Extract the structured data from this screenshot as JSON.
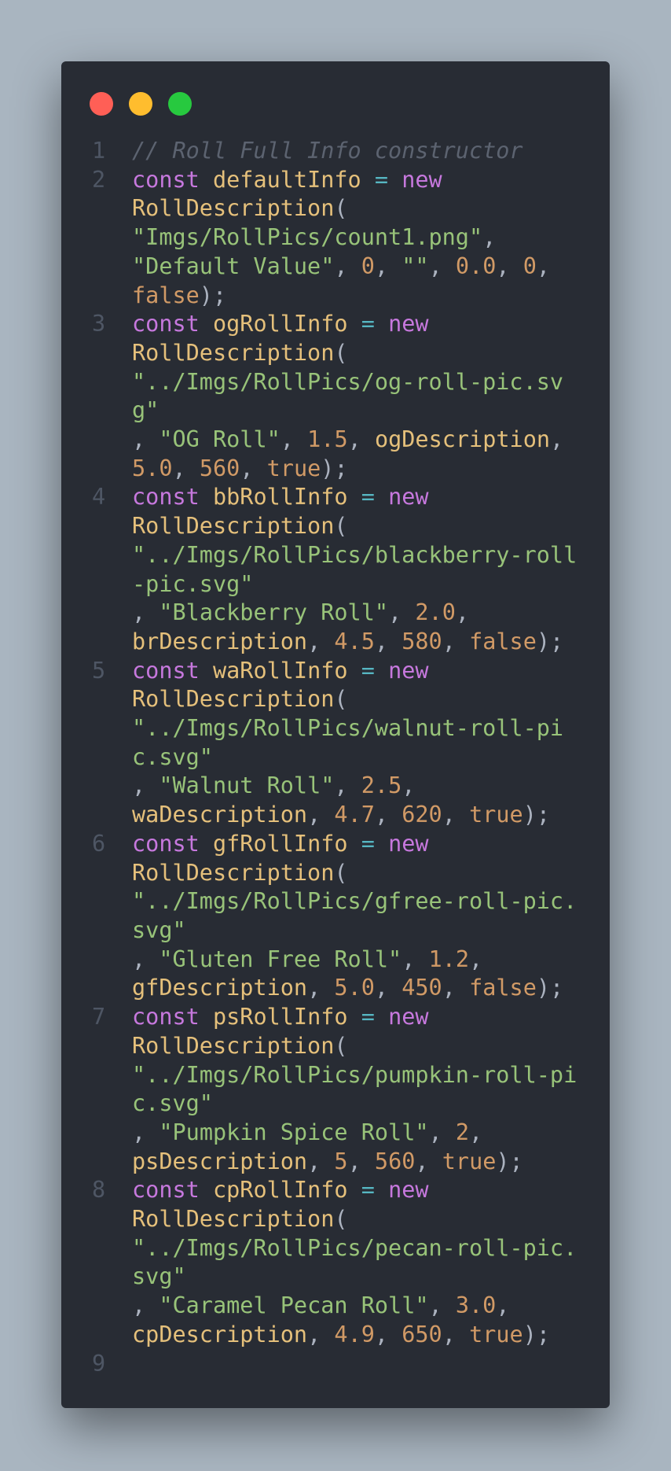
{
  "window": {
    "dots": [
      {
        "name": "close",
        "color": "#ff5f56"
      },
      {
        "name": "minimize",
        "color": "#ffbd2e"
      },
      {
        "name": "maximize",
        "color": "#27c93f"
      }
    ]
  },
  "code": {
    "comment": "// Roll Full Info constructor",
    "line_numbers": [
      "1",
      "2",
      "3",
      "4",
      "5",
      "6",
      "7",
      "8",
      "9"
    ],
    "entries": [
      {
        "kw": "const",
        "var": "defaultInfo",
        "op": "=",
        "new": "new",
        "cls": "RollDescription",
        "open": "(",
        "path": "\"Imgs/RollPics/count1.png\"",
        "sep1": ",",
        "name": "\"Default Value\"",
        "sep2": ",",
        "price": "0",
        "sep3": ",",
        "desc": "\"\"",
        "sep4": ",",
        "rating": "0.0",
        "sep5": ",",
        "count": "0",
        "sep6": ",",
        "flag": "false",
        "close": ");"
      },
      {
        "kw": "const",
        "var": "ogRollInfo",
        "op": "=",
        "new": "new",
        "cls": "RollDescription",
        "open": "(",
        "path": "\"../Imgs/RollPics/og-roll-pic.svg\"",
        "sep1": ",",
        "name": "\"OG Roll\"",
        "sep2": ",",
        "price": "1.5",
        "sep3": ",",
        "desc": "ogDescription",
        "sep4": ",",
        "rating": "5.0",
        "sep5": ",",
        "count": "560",
        "sep6": ",",
        "flag": "true",
        "close": ");"
      },
      {
        "kw": "const",
        "var": "bbRollInfo",
        "op": "=",
        "new": "new",
        "cls": "RollDescription",
        "open": "(",
        "path": "\"../Imgs/RollPics/blackberry-roll-pic.svg\"",
        "sep1": ",",
        "name": "\"Blackberry Roll\"",
        "sep2": ",",
        "price": "2.0",
        "sep3": ",",
        "desc": "brDescription",
        "sep4": ",",
        "rating": "4.5",
        "sep5": ",",
        "count": "580",
        "sep6": ",",
        "flag": "false",
        "close": ");"
      },
      {
        "kw": "const",
        "var": "waRollInfo",
        "op": "=",
        "new": "new",
        "cls": "RollDescription",
        "open": "(",
        "path": "\"../Imgs/RollPics/walnut-roll-pic.svg\"",
        "sep1": ",",
        "name": "\"Walnut Roll\"",
        "sep2": ",",
        "price": "2.5",
        "sep3": ",",
        "desc": "waDescription",
        "sep4": ",",
        "rating": "4.7",
        "sep5": ",",
        "count": "620",
        "sep6": ",",
        "flag": "true",
        "close": ");"
      },
      {
        "kw": "const",
        "var": "gfRollInfo",
        "op": "=",
        "new": "new",
        "cls": "RollDescription",
        "open": "(",
        "path": "\"../Imgs/RollPics/gfree-roll-pic.svg\"",
        "sep1": ",",
        "name": "\"Gluten Free Roll\"",
        "sep2": ",",
        "price": "1.2",
        "sep3": ",",
        "desc": "gfDescription",
        "sep4": ",",
        "rating": "5.0",
        "sep5": ",",
        "count": "450",
        "sep6": ",",
        "flag": "false",
        "close": ");"
      },
      {
        "kw": "const",
        "var": "psRollInfo",
        "op": "=",
        "new": "new",
        "cls": "RollDescription",
        "open": "(",
        "path": "\"../Imgs/RollPics/pumpkin-roll-pic.svg\"",
        "sep1": ",",
        "name": "\"Pumpkin Spice Roll\"",
        "sep2": ",",
        "price": "2",
        "sep3": ",",
        "desc": "psDescription",
        "sep4": ",",
        "rating": "5",
        "sep5": ",",
        "count": "560",
        "sep6": ",",
        "flag": "true",
        "close": ");"
      },
      {
        "kw": "const",
        "var": "cpRollInfo",
        "op": "=",
        "new": "new",
        "cls": "RollDescription",
        "open": "(",
        "path": "\"../Imgs/RollPics/pecan-roll-pic.svg\"",
        "sep1": ",",
        "name": "\"Caramel Pecan Roll\"",
        "sep2": ",",
        "price": "3.0",
        "sep3": ",",
        "desc": "cpDescription",
        "sep4": ",",
        "rating": "4.9",
        "sep5": ",",
        "count": "650",
        "sep6": ",",
        "flag": "true",
        "close": ");"
      }
    ]
  }
}
